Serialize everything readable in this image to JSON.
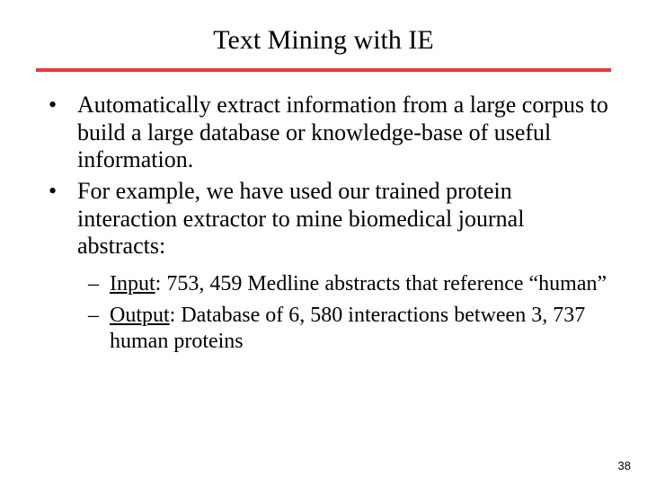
{
  "title": "Text Mining with IE",
  "bullets": [
    "Automatically extract information from a large corpus to build a large database or knowledge-base of useful information.",
    "For example, we have used our trained protein interaction extractor to mine biomedical journal abstracts:"
  ],
  "sub": [
    {
      "label": "Input",
      "text": ": 753, 459 Medline abstracts that reference “human”"
    },
    {
      "label": "Output",
      "text": ": Database of 6, 580 interactions between 3, 737 human proteins"
    }
  ],
  "page_number": "38"
}
